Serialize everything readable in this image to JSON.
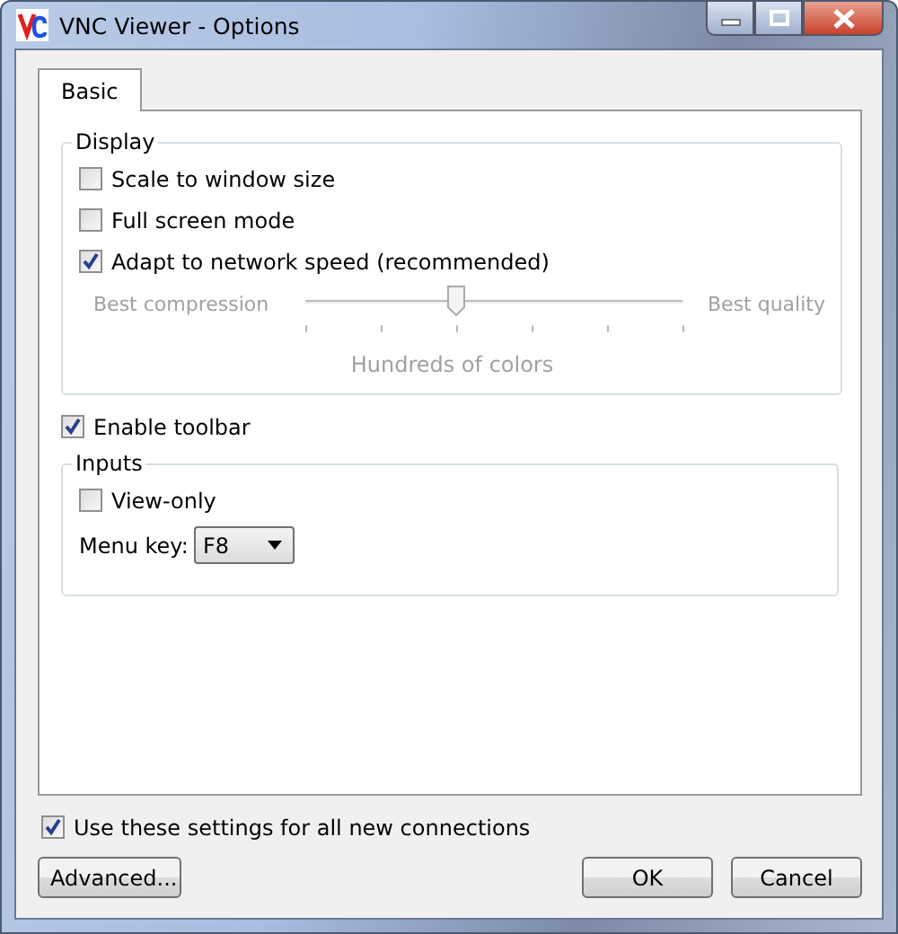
{
  "window": {
    "title": "VNC Viewer - Options"
  },
  "tabs": [
    {
      "label": "Basic",
      "selected": true
    }
  ],
  "display": {
    "title": "Display",
    "checkboxes": [
      {
        "label": "Scale to window size",
        "checked": false
      },
      {
        "label": "Full screen mode",
        "checked": false
      },
      {
        "label": "Adapt to network speed (recommended)",
        "checked": true
      }
    ],
    "quality": {
      "disabled": true,
      "left": "Best compression",
      "right": "Best quality",
      "level": 0.4,
      "caption": "Hundreds of colors"
    }
  },
  "enable_toolbar": {
    "label": "Enable toolbar",
    "checked": true
  },
  "inputs": {
    "title": "Inputs",
    "view_only": {
      "label": "View-only",
      "checked": false
    },
    "menu_key": {
      "label": "Menu key:",
      "value": "F8"
    }
  },
  "use_for_all": {
    "label": "Use these settings for all new connections",
    "checked": true
  },
  "buttons": {
    "left": [
      "Advanced..."
    ],
    "right": [
      "OK",
      "Cancel"
    ]
  }
}
